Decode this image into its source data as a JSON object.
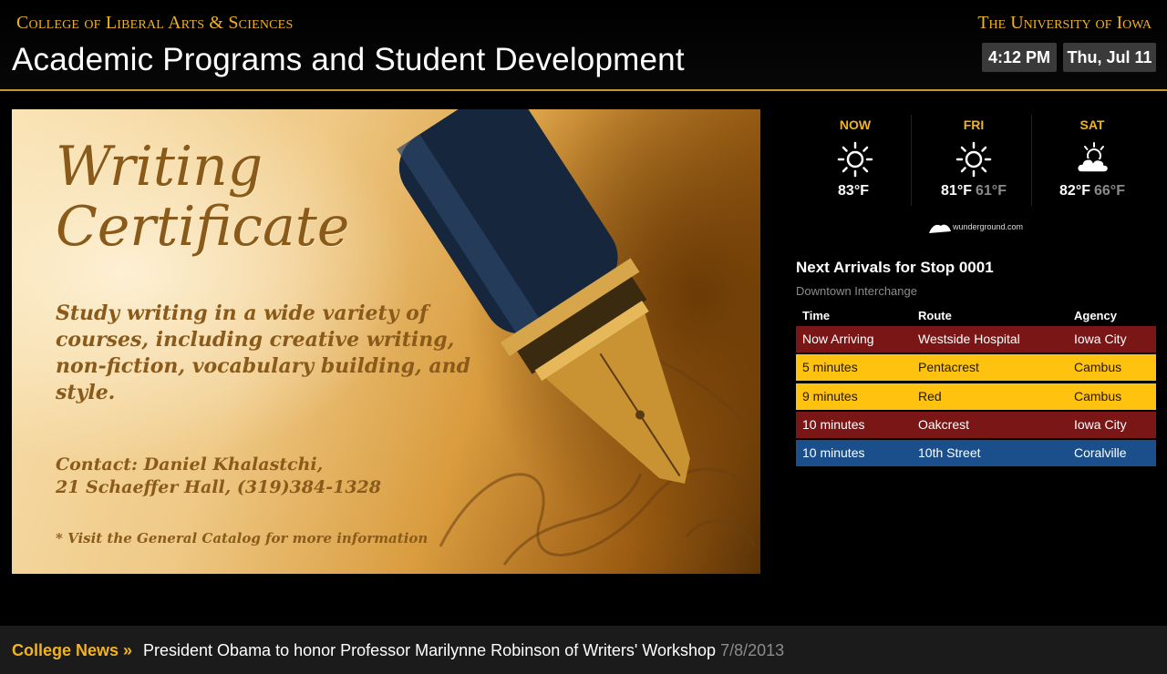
{
  "header": {
    "college": "College of Liberal Arts & Sciences",
    "department": "Academic Programs and Student Development",
    "university": "The University of Iowa",
    "time": "4:12 PM",
    "date": "Thu, Jul 11"
  },
  "slide": {
    "title_line1": "Writing",
    "title_line2": "Certificate",
    "body": "Study writing in a wide variety of courses, including creative writing, non-fiction, vocabulary building, and style.",
    "contact_line1": "Contact: Daniel Khalastchi,",
    "contact_line2": "21 Schaeffer Hall, (319)384-1328",
    "note": "* Visit the General Catalog for more information"
  },
  "weather": {
    "days": [
      {
        "label": "NOW",
        "icon": "sun-icon",
        "high": "83°F",
        "low": ""
      },
      {
        "label": "FRI",
        "icon": "sun-icon",
        "high": "81°F",
        "low": "61°F"
      },
      {
        "label": "SAT",
        "icon": "partly-cloudy-icon",
        "high": "82°F",
        "low": "66°F"
      }
    ],
    "provider": "wunderground.com"
  },
  "arrivals": {
    "title": "Next Arrivals for Stop 0001",
    "subtitle": "Downtown Interchange",
    "columns": [
      "Time",
      "Route",
      "Agency"
    ],
    "rows": [
      {
        "time": "Now Arriving",
        "route": "Westside Hospital",
        "agency": "Iowa City",
        "bg": "#7a1616",
        "fg": "#ffffff"
      },
      {
        "time": "5 minutes",
        "route": "Pentacrest",
        "agency": "Cambus",
        "bg": "#ffc20e",
        "fg": "#1a1a1a"
      },
      {
        "time": "9 minutes",
        "route": "Red",
        "agency": "Cambus",
        "bg": "#ffc20e",
        "fg": "#1a1a1a"
      },
      {
        "time": "10 minutes",
        "route": "Oakcrest",
        "agency": "Iowa City",
        "bg": "#7a1616",
        "fg": "#ffffff"
      },
      {
        "time": "10 minutes",
        "route": "10th Street",
        "agency": "Coralville",
        "bg": "#1a4f8c",
        "fg": "#ffffff"
      }
    ]
  },
  "news": {
    "label": "College News »",
    "headline": "President Obama to honor Professor Marilynne Robinson of Writers' Workshop",
    "date": "7/8/2013"
  },
  "colors": {
    "gold": "#f0b323",
    "header_rule": "#c89a2c"
  }
}
